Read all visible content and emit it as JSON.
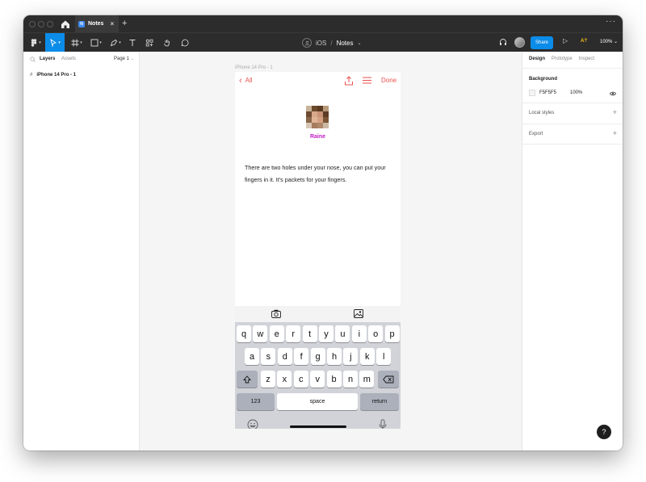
{
  "tab": {
    "title": "Notes",
    "close": "×",
    "add": "+"
  },
  "window_menu": "···",
  "toolbar": {
    "breadcrumb_project": "iOS",
    "breadcrumb_sep": "/",
    "breadcrumb_file": "Notes",
    "share_label": "Share",
    "a11y_label": "A?",
    "zoom_label": "100%"
  },
  "left_panel": {
    "tab_layers": "Layers",
    "tab_assets": "Assets",
    "page_label": "Page 1",
    "layers": [
      {
        "name": "iPhone 14 Pro - 1"
      }
    ]
  },
  "canvas": {
    "frame_label": "iPhone 14 Pro - 1",
    "nav": {
      "back_label": "All",
      "done_label": "Done"
    },
    "contact_name": "Raine",
    "note_text": "There are two holes under your nose, you can put your fingers in it.  It's packets for your fingers.",
    "keyboard": {
      "row1": [
        "q",
        "w",
        "e",
        "r",
        "t",
        "y",
        "u",
        "i",
        "o",
        "p"
      ],
      "row2": [
        "a",
        "s",
        "d",
        "f",
        "g",
        "h",
        "j",
        "k",
        "l"
      ],
      "row3": [
        "z",
        "x",
        "c",
        "v",
        "b",
        "n",
        "m"
      ],
      "numbers_label": "123",
      "space_label": "space",
      "return_label": "return"
    }
  },
  "right_panel": {
    "tab_design": "Design",
    "tab_prototype": "Prototype",
    "tab_inspect": "Inspect",
    "background_label": "Background",
    "background_hex": "F5F5F5",
    "background_opacity": "100%",
    "local_styles_label": "Local styles",
    "export_label": "Export"
  },
  "help_label": "?",
  "colors": {
    "accent": "#0c8ce9",
    "ios_red": "#e8534b",
    "contact_name": "#c11cc4"
  }
}
